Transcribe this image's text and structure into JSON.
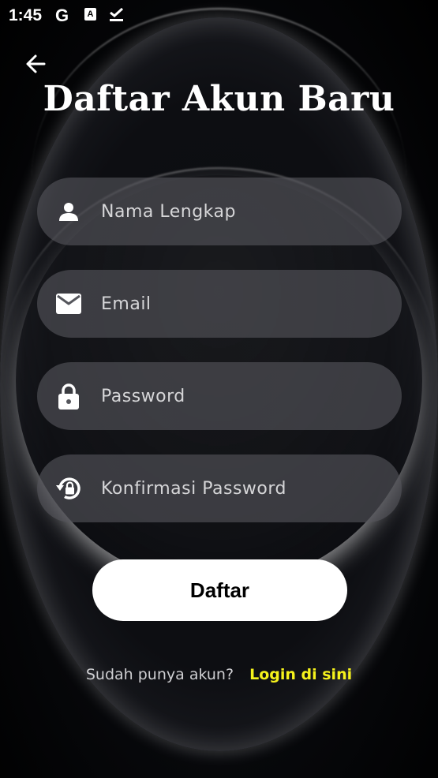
{
  "status_bar": {
    "time": "1:45",
    "google_glyph": "G",
    "a_glyph": "A",
    "icons": [
      "google-icon",
      "translate-icon",
      "check-icon"
    ]
  },
  "header": {
    "back_icon": "arrow-back-icon",
    "title": "Daftar Akun Baru"
  },
  "form": {
    "fields": [
      {
        "icon": "person-icon",
        "placeholder": "Nama Lengkap",
        "value": ""
      },
      {
        "icon": "mail-icon",
        "placeholder": "Email",
        "value": ""
      },
      {
        "icon": "lock-icon",
        "placeholder": "Password",
        "value": ""
      },
      {
        "icon": "lock-reset-icon",
        "placeholder": "Konfirmasi Password",
        "value": ""
      }
    ],
    "submit_label": "Daftar"
  },
  "footer": {
    "prompt": "Sudah punya akun?",
    "link": "Login di sini"
  },
  "colors": {
    "background": "#000000",
    "field_bg": "#55565C",
    "button_bg": "#FFFFFF",
    "link": "#F5F21C"
  }
}
